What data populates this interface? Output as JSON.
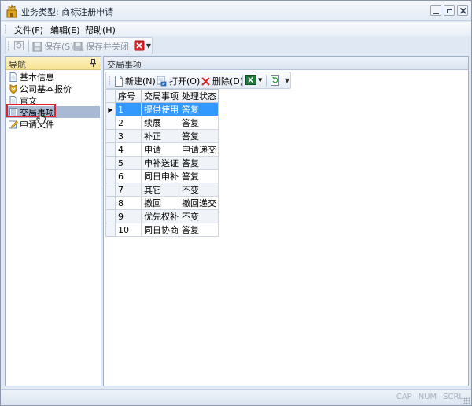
{
  "window": {
    "title": "业务类型: 商标注册申请"
  },
  "menu": {
    "items": [
      "文件(F)",
      "编辑(E)",
      "帮助(H)"
    ]
  },
  "toolbar": {
    "save_label": "保存(S)",
    "save_close_label": "保存并关闭"
  },
  "nav": {
    "title": "导航",
    "items": [
      {
        "label": "基本信息",
        "icon": "document-icon"
      },
      {
        "label": "公司基本报价",
        "icon": "shield-icon"
      },
      {
        "label": "官文",
        "icon": "document-icon"
      },
      {
        "label": "交局事项",
        "icon": "list-icon"
      },
      {
        "label": "申请文件",
        "icon": "edit-icon"
      }
    ],
    "selected_index": 3
  },
  "content": {
    "title": "交局事项",
    "toolbar": {
      "new_label": "新建(N)",
      "open_label": "打开(O)",
      "delete_label": "删除(D)"
    },
    "table": {
      "columns": [
        "序号",
        "交局事项",
        "处理状态"
      ],
      "rows": [
        [
          "1",
          "提供使用证",
          "答复"
        ],
        [
          "2",
          "续展",
          "答复"
        ],
        [
          "3",
          "补正",
          "答复"
        ],
        [
          "4",
          "申请",
          "申请递交"
        ],
        [
          "5",
          "申补送证明",
          "答复"
        ],
        [
          "6",
          "同日申补送",
          "答复"
        ],
        [
          "7",
          "其它",
          "不变"
        ],
        [
          "8",
          "撤回",
          "撤回递交"
        ],
        [
          "9",
          "优先权补充",
          "不变"
        ],
        [
          "10",
          "同日协商",
          "答复"
        ]
      ],
      "selected_row": 0
    }
  },
  "statusbar": {
    "indicators": [
      "CAP",
      "NUM",
      "SCRL"
    ]
  },
  "colors": {
    "selection": "#3399ff",
    "nav_header": "#f8e291",
    "highlight_box": "#e0202a"
  }
}
